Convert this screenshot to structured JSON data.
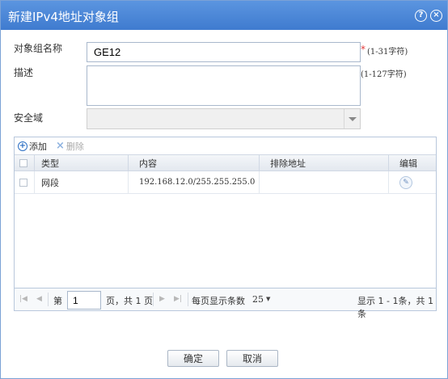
{
  "dialog": {
    "title": "新建IPv4地址对象组",
    "help_icon": "help-icon",
    "close_icon": "close-icon"
  },
  "form": {
    "name_label": "对象组名称",
    "name_value": "GE12",
    "name_required": "*",
    "name_hint": "(1-31字符)",
    "desc_label": "描述",
    "desc_value": "",
    "desc_hint": "(1-127字符)",
    "zone_label": "安全域",
    "zone_value": ""
  },
  "grid": {
    "toolbar": {
      "add_label": "添加",
      "delete_label": "删除"
    },
    "columns": [
      "类型",
      "内容",
      "排除地址",
      "编辑"
    ],
    "rows": [
      {
        "type": "网段",
        "content": "192.168.12.0/255.255.255.0",
        "exclude": "",
        "edit_icon": "pencil-icon"
      }
    ]
  },
  "pager": {
    "page_prefix": "第",
    "current_page": "1",
    "page_suffix": "页，共 1 页",
    "per_page_label": "每页显示条数",
    "per_page_value": "25",
    "summary": "显示 1 - 1条，共 1 条"
  },
  "buttons": {
    "ok": "确定",
    "cancel": "取消"
  },
  "colors": {
    "titlebar": "#4a86d8",
    "accent": "#2c6fc4",
    "required": "#e23a3a"
  }
}
